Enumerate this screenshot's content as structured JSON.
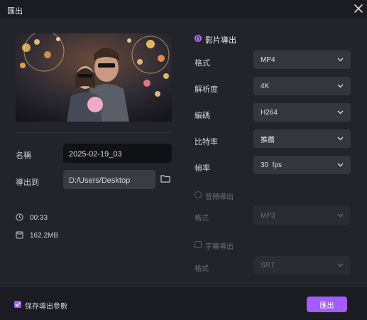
{
  "window": {
    "title": "匯出"
  },
  "details": {
    "name_label": "名稱",
    "name_value": "2025-02-19_03",
    "path_label": "導出到",
    "path_value": "D:/Users/Desktop",
    "duration": "00:33",
    "size": "162.2MB"
  },
  "video_export": {
    "label": "影片導出",
    "format_label": "格式",
    "format_value": "MP4",
    "resolution_label": "解析度",
    "resolution_value": "4K",
    "codec_label": "編碼",
    "codec_value": "H264",
    "bitrate_label": "比特率",
    "bitrate_value": "推薦",
    "framerate_label": "幀率",
    "framerate_value": "30  fps"
  },
  "audio_export": {
    "label": "音頻導出",
    "format_label": "格式",
    "format_value": "MP3"
  },
  "subtitle_export": {
    "label": "字幕導出",
    "format_label": "格式",
    "format_value": "SRT"
  },
  "footer": {
    "save_params_label": "保存導出參數",
    "export_button": "匯出"
  },
  "colors": {
    "accent": "#a35cff",
    "background": "#23242b",
    "footer": "#1b1c22"
  }
}
